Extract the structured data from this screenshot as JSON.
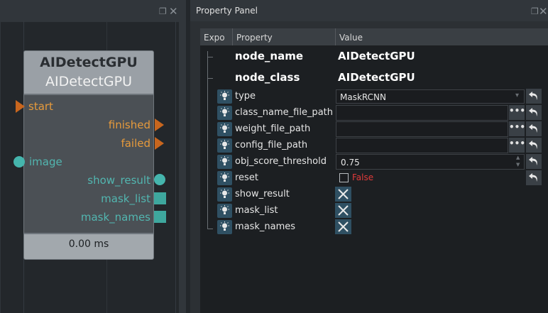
{
  "node_editor": {
    "node": {
      "title": "AIDetectGPU",
      "subtitle": "AIDetectGPU",
      "inputs_exec": [
        "start"
      ],
      "outputs_exec": [
        "finished",
        "failed"
      ],
      "inputs_data": [
        "image"
      ],
      "outputs_data": [
        "show_result",
        "mask_list",
        "mask_names"
      ],
      "elapsed": "0.00 ms"
    },
    "icons": {
      "restore": "restore-window-icon",
      "close": "close-icon"
    }
  },
  "property_panel": {
    "title": "Property Panel",
    "columns": [
      "Expo",
      "Property",
      "Value"
    ],
    "header_rows": [
      {
        "property": "node_name",
        "value": "AIDetectGPU"
      },
      {
        "property": "node_class",
        "value": "AIDetectGPU"
      }
    ],
    "rows": [
      {
        "property": "type",
        "value": "MaskRCNN",
        "widget": "dropdown"
      },
      {
        "property": "class_name_file_path",
        "value": "",
        "widget": "file"
      },
      {
        "property": "weight_file_path",
        "value": "",
        "widget": "file"
      },
      {
        "property": "config_file_path",
        "value": "",
        "widget": "file"
      },
      {
        "property": "obj_score_threshold",
        "value": "0.75",
        "widget": "spin"
      },
      {
        "property": "reset",
        "value": "False",
        "widget": "checkbox"
      },
      {
        "property": "show_result",
        "value": "",
        "widget": "disabled"
      },
      {
        "property": "mask_list",
        "value": "",
        "widget": "disabled"
      },
      {
        "property": "mask_names",
        "value": "",
        "widget": "disabled"
      }
    ],
    "dots_label": "•••"
  },
  "colors": {
    "exec_port": "#c8661e",
    "data_port": "#45b5ad",
    "false_text": "#e03a3a"
  }
}
